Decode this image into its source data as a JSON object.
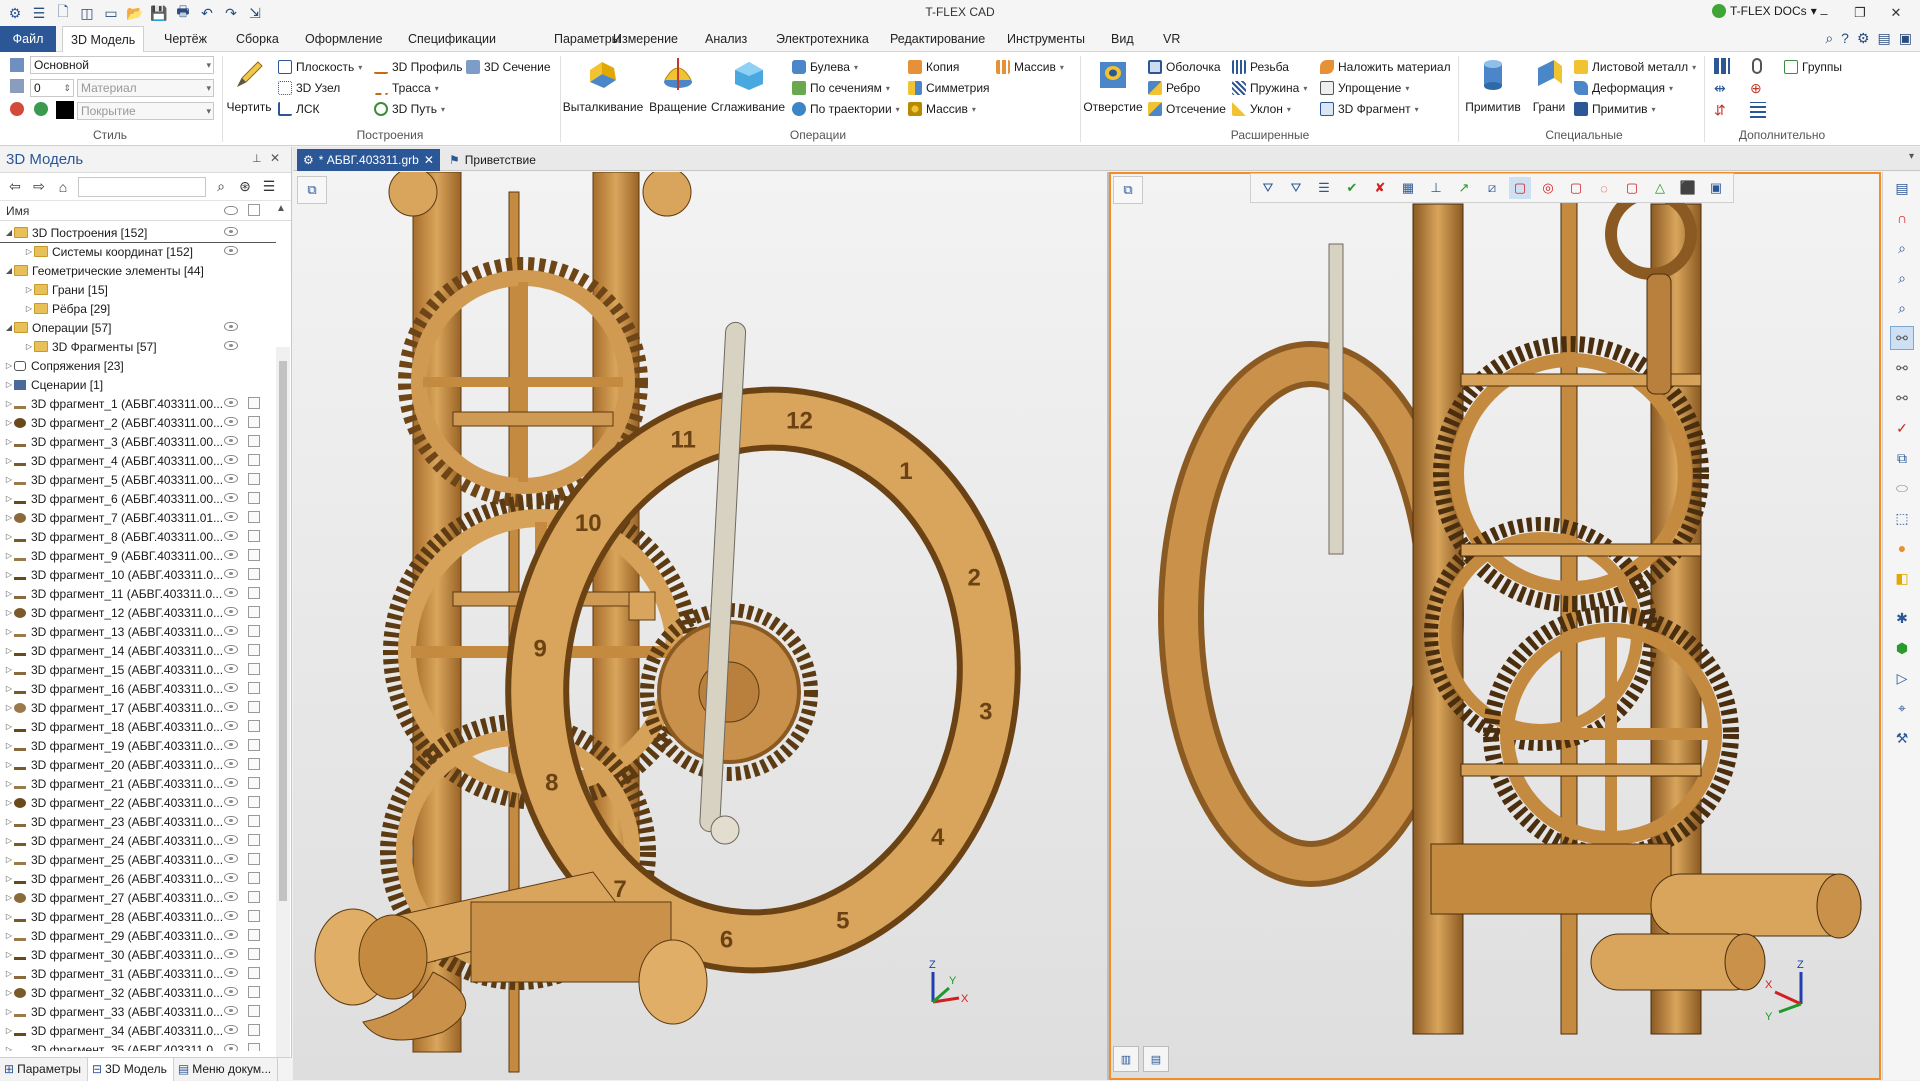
{
  "app": {
    "title": "T-FLEX CAD",
    "docs_label": "T-FLEX DOCs",
    "docs_dropdown": "▾"
  },
  "window_controls": {
    "minimize": "–",
    "restore": "❐",
    "close": "✕"
  },
  "menu": {
    "file": "Файл",
    "tabs": [
      "3D Модель",
      "Чертёж",
      "Сборка",
      "Оформление",
      "Спецификации",
      "Параметры",
      "Измерение",
      "Анализ",
      "Электротехника",
      "Редактирование",
      "Инструменты",
      "Вид",
      "VR"
    ]
  },
  "ribbon": {
    "style": {
      "layer_value": "Основной",
      "level_value": "0",
      "material_placeholder": "Материал",
      "coating_placeholder": "Покрытие",
      "group_label": "Стиль"
    },
    "construct": {
      "draw_label": "Чертить",
      "plane": "Плоскость",
      "node3d": "3D Узел",
      "lsk": "ЛСК",
      "profile3d": "3D Профиль",
      "route": "Трасса",
      "path3d": "3D Путь",
      "section3d": "3D Сечение",
      "group_label": "Построения"
    },
    "operations": {
      "extrude": "Выталкивание",
      "rotate": "Вращение",
      "smooth": "Сглаживание",
      "boolean": "Булева",
      "by_sections": "По сечениям",
      "by_path": "По траектории",
      "copy": "Копия",
      "symmetry": "Симметрия",
      "array1": "Массив",
      "array2": "Массив",
      "group_label": "Операции"
    },
    "extended": {
      "hole": "Отверстие",
      "shell": "Оболочка",
      "rib": "Ребро",
      "cut": "Отсечение",
      "thread": "Резьба",
      "spring": "Пружина",
      "slope": "Уклон",
      "apply_material": "Наложить материал",
      "simplify": "Упрощение",
      "fragment3d": "3D Фрагмент",
      "group_label": "Расширенные"
    },
    "special": {
      "primitive": "Примитив",
      "faces": "Грани",
      "sheet_metal": "Листовой металл",
      "deformation": "Деформация",
      "primitive2": "Примитив",
      "group_label": "Специальные"
    },
    "additional": {
      "groups": "Группы",
      "group_label": "Дополнительно"
    }
  },
  "left_panel": {
    "title": "3D Модель",
    "pin": "📌",
    "close": "✕",
    "column_name": "Имя",
    "tree": [
      {
        "label": "3D Построения [152]",
        "type": "folder",
        "indent": 0,
        "expanded": true,
        "selected": true,
        "eye": true,
        "doc": false
      },
      {
        "label": "Системы координат [152]",
        "type": "folder",
        "indent": 1,
        "expanded": false,
        "eye": true,
        "doc": false
      },
      {
        "label": "Геометрические элементы [44]",
        "type": "folder",
        "indent": 0,
        "expanded": true,
        "eye": false,
        "doc": false
      },
      {
        "label": "Грани [15]",
        "type": "folder",
        "indent": 1,
        "expanded": false,
        "eye": false,
        "doc": false
      },
      {
        "label": "Рёбра [29]",
        "type": "folder",
        "indent": 1,
        "expanded": false,
        "eye": false,
        "doc": false
      },
      {
        "label": "Операции [57]",
        "type": "folder",
        "indent": 0,
        "expanded": true,
        "eye": true,
        "doc": false
      },
      {
        "label": "3D Фрагменты [57]",
        "type": "folder",
        "indent": 1,
        "expanded": false,
        "eye": true,
        "doc": false
      },
      {
        "label": "Сопряжения [23]",
        "type": "mate",
        "indent": 0,
        "expanded": false,
        "eye": false,
        "doc": false
      },
      {
        "label": "Сценарии [1]",
        "type": "scenario",
        "indent": 0,
        "expanded": false,
        "eye": false,
        "doc": false
      },
      {
        "label": "3D фрагмент_1 (АБВГ.403311.00...",
        "type": "frag",
        "indent": 0,
        "eye": true,
        "doc": true
      },
      {
        "label": "3D фрагмент_2 (АБВГ.403311.00...",
        "type": "frag",
        "indent": 0,
        "eye": true,
        "doc": true
      },
      {
        "label": "3D фрагмент_3 (АБВГ.403311.00...",
        "type": "frag",
        "indent": 0,
        "eye": true,
        "doc": true
      },
      {
        "label": "3D фрагмент_4 (АБВГ.403311.00...",
        "type": "frag",
        "indent": 0,
        "eye": true,
        "doc": true
      },
      {
        "label": "3D фрагмент_5 (АБВГ.403311.00...",
        "type": "frag",
        "indent": 0,
        "eye": true,
        "doc": true
      },
      {
        "label": "3D фрагмент_6 (АБВГ.403311.00...",
        "type": "frag",
        "indent": 0,
        "eye": true,
        "doc": true
      },
      {
        "label": "3D фрагмент_7 (АБВГ.403311.01...",
        "type": "frag",
        "indent": 0,
        "eye": true,
        "doc": true
      },
      {
        "label": "3D фрагмент_8 (АБВГ.403311.00...",
        "type": "frag",
        "indent": 0,
        "eye": true,
        "doc": true
      },
      {
        "label": "3D фрагмент_9 (АБВГ.403311.00...",
        "type": "frag",
        "indent": 0,
        "eye": true,
        "doc": true
      },
      {
        "label": "3D фрагмент_10 (АБВГ.403311.0...",
        "type": "frag",
        "indent": 0,
        "eye": true,
        "doc": true
      },
      {
        "label": "3D фрагмент_11 (АБВГ.403311.0...",
        "type": "frag",
        "indent": 0,
        "eye": true,
        "doc": true
      },
      {
        "label": "3D фрагмент_12 (АБВГ.403311.0...",
        "type": "frag",
        "indent": 0,
        "eye": true,
        "doc": true
      },
      {
        "label": "3D фрагмент_13 (АБВГ.403311.0...",
        "type": "frag",
        "indent": 0,
        "eye": true,
        "doc": true
      },
      {
        "label": "3D фрагмент_14 (АБВГ.403311.0...",
        "type": "frag",
        "indent": 0,
        "eye": true,
        "doc": true
      },
      {
        "label": "3D фрагмент_15 (АБВГ.403311.0...",
        "type": "frag",
        "indent": 0,
        "eye": true,
        "doc": true
      },
      {
        "label": "3D фрагмент_16 (АБВГ.403311.0...",
        "type": "frag",
        "indent": 0,
        "eye": true,
        "doc": true
      },
      {
        "label": "3D фрагмент_17 (АБВГ.403311.0...",
        "type": "frag",
        "indent": 0,
        "eye": true,
        "doc": true
      },
      {
        "label": "3D фрагмент_18 (АБВГ.403311.0...",
        "type": "frag",
        "indent": 0,
        "eye": true,
        "doc": true
      },
      {
        "label": "3D фрагмент_19 (АБВГ.403311.0...",
        "type": "frag",
        "indent": 0,
        "eye": true,
        "doc": true
      },
      {
        "label": "3D фрагмент_20 (АБВГ.403311.0...",
        "type": "frag",
        "indent": 0,
        "eye": true,
        "doc": true
      },
      {
        "label": "3D фрагмент_21 (АБВГ.403311.0...",
        "type": "frag",
        "indent": 0,
        "eye": true,
        "doc": true
      },
      {
        "label": "3D фрагмент_22 (АБВГ.403311.0...",
        "type": "frag",
        "indent": 0,
        "eye": true,
        "doc": true
      },
      {
        "label": "3D фрагмент_23 (АБВГ.403311.0...",
        "type": "frag",
        "indent": 0,
        "eye": true,
        "doc": true
      },
      {
        "label": "3D фрагмент_24 (АБВГ.403311.0...",
        "type": "frag",
        "indent": 0,
        "eye": true,
        "doc": true
      },
      {
        "label": "3D фрагмент_25 (АБВГ.403311.0...",
        "type": "frag",
        "indent": 0,
        "eye": true,
        "doc": true
      },
      {
        "label": "3D фрагмент_26 (АБВГ.403311.0...",
        "type": "frag",
        "indent": 0,
        "eye": true,
        "doc": true
      },
      {
        "label": "3D фрагмент_27 (АБВГ.403311.0...",
        "type": "frag",
        "indent": 0,
        "eye": true,
        "doc": true
      },
      {
        "label": "3D фрагмент_28 (АБВГ.403311.0...",
        "type": "frag",
        "indent": 0,
        "eye": true,
        "doc": true
      },
      {
        "label": "3D фрагмент_29 (АБВГ.403311.0...",
        "type": "frag",
        "indent": 0,
        "eye": true,
        "doc": true
      },
      {
        "label": "3D фрагмент_30 (АБВГ.403311.0...",
        "type": "frag",
        "indent": 0,
        "eye": true,
        "doc": true
      },
      {
        "label": "3D фрагмент_31 (АБВГ.403311.0...",
        "type": "frag",
        "indent": 0,
        "eye": true,
        "doc": true
      },
      {
        "label": "3D фрагмент_32 (АБВГ.403311.0...",
        "type": "frag",
        "indent": 0,
        "eye": true,
        "doc": true
      },
      {
        "label": "3D фрагмент_33 (АБВГ.403311.0...",
        "type": "frag",
        "indent": 0,
        "eye": true,
        "doc": true
      },
      {
        "label": "3D фрагмент_34 (АБВГ.403311.0...",
        "type": "frag",
        "indent": 0,
        "eye": true,
        "doc": true
      },
      {
        "label": "3D фрагмент_35 (АБВГ.403311.0...",
        "type": "frag",
        "indent": 0,
        "eye": true,
        "doc": true
      }
    ],
    "bottom_tabs": [
      "Параметры",
      "3D Модель",
      "Меню докум..."
    ]
  },
  "doc_tabs": [
    {
      "label": "* АБВГ.403311.grb",
      "active": true,
      "close": "✕"
    },
    {
      "label": "Приветствие",
      "active": false
    }
  ],
  "viewport": {
    "axis_x": "X",
    "axis_y": "Y",
    "axis_z": "Z",
    "dial_numbers": [
      "12",
      "1",
      "2",
      "3",
      "4",
      "5",
      "6",
      "7",
      "8",
      "9",
      "10",
      "11"
    ]
  },
  "colors": {
    "accent_blue": "#2b5797",
    "wood_light": "#d9a55c",
    "wood_mid": "#c48a3f",
    "wood_dark": "#8a5a22",
    "active_border": "#f28c28",
    "docs_green": "#3fa535"
  }
}
